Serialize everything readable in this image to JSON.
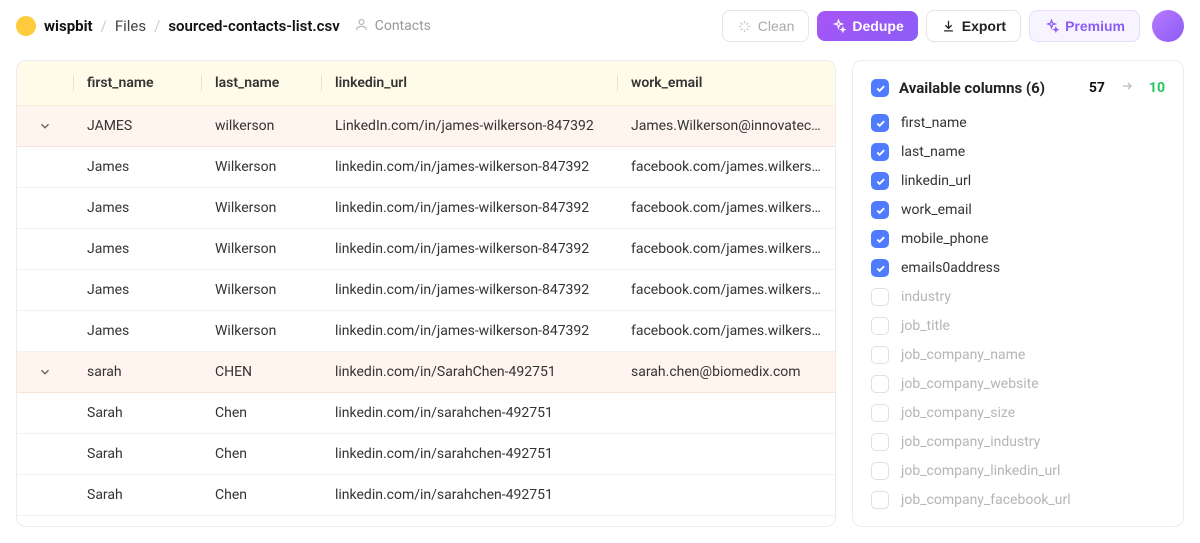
{
  "breadcrumb": {
    "brand": "wispbit",
    "files": "Files",
    "filename": "sourced-contacts-list.csv",
    "subtype": "Contacts"
  },
  "actions": {
    "clean": "Clean",
    "dedupe": "Dedupe",
    "export": "Export",
    "premium": "Premium"
  },
  "columns": {
    "first_name": "first_name",
    "last_name": "last_name",
    "linkedin_url": "linkedin_url",
    "work_email": "work_email"
  },
  "rows": [
    {
      "group": true,
      "first_name": "JAMES",
      "last_name": "wilkerson",
      "linkedin_url": "LinkedIn.com/in/james-wilkerson-847392",
      "work_email": "James.Wilkerson@innovatech.com"
    },
    {
      "group": false,
      "first_name": "James",
      "last_name": "Wilkerson",
      "linkedin_url": "linkedin.com/in/james-wilkerson-847392",
      "work_email": "facebook.com/james.wilkerson"
    },
    {
      "group": false,
      "first_name": "James",
      "last_name": "Wilkerson",
      "linkedin_url": "linkedin.com/in/james-wilkerson-847392",
      "work_email": "facebook.com/james.wilkerson"
    },
    {
      "group": false,
      "first_name": "James",
      "last_name": "Wilkerson",
      "linkedin_url": "linkedin.com/in/james-wilkerson-847392",
      "work_email": "facebook.com/james.wilkerson"
    },
    {
      "group": false,
      "first_name": "James",
      "last_name": "Wilkerson",
      "linkedin_url": "linkedin.com/in/james-wilkerson-847392",
      "work_email": "facebook.com/james.wilkerson"
    },
    {
      "group": false,
      "first_name": "James",
      "last_name": "Wilkerson",
      "linkedin_url": "linkedin.com/in/james-wilkerson-847392",
      "work_email": "facebook.com/james.wilkerson"
    },
    {
      "group": true,
      "first_name": "sarah",
      "last_name": "CHEN",
      "linkedin_url": "linkedin.com/in/SarahChen-492751",
      "work_email": "sarah.chen@biomedix.com"
    },
    {
      "group": false,
      "first_name": "Sarah",
      "last_name": "Chen",
      "linkedin_url": "linkedin.com/in/sarahchen-492751",
      "work_email": ""
    },
    {
      "group": false,
      "first_name": "Sarah",
      "last_name": "Chen",
      "linkedin_url": "linkedin.com/in/sarahchen-492751",
      "work_email": ""
    },
    {
      "group": false,
      "first_name": "Sarah",
      "last_name": "Chen",
      "linkedin_url": "linkedin.com/in/sarahchen-492751",
      "work_email": ""
    }
  ],
  "side": {
    "title": "Available columns (6)",
    "before": "57",
    "after": "10",
    "items": [
      {
        "label": "first_name",
        "checked": true
      },
      {
        "label": "last_name",
        "checked": true
      },
      {
        "label": "linkedin_url",
        "checked": true
      },
      {
        "label": "work_email",
        "checked": true
      },
      {
        "label": "mobile_phone",
        "checked": true
      },
      {
        "label": "emails0address",
        "checked": true
      },
      {
        "label": "industry",
        "checked": false
      },
      {
        "label": "job_title",
        "checked": false
      },
      {
        "label": "job_company_name",
        "checked": false
      },
      {
        "label": "job_company_website",
        "checked": false
      },
      {
        "label": "job_company_size",
        "checked": false
      },
      {
        "label": "job_company_industry",
        "checked": false
      },
      {
        "label": "job_company_linkedin_url",
        "checked": false
      },
      {
        "label": "job_company_facebook_url",
        "checked": false
      }
    ]
  }
}
